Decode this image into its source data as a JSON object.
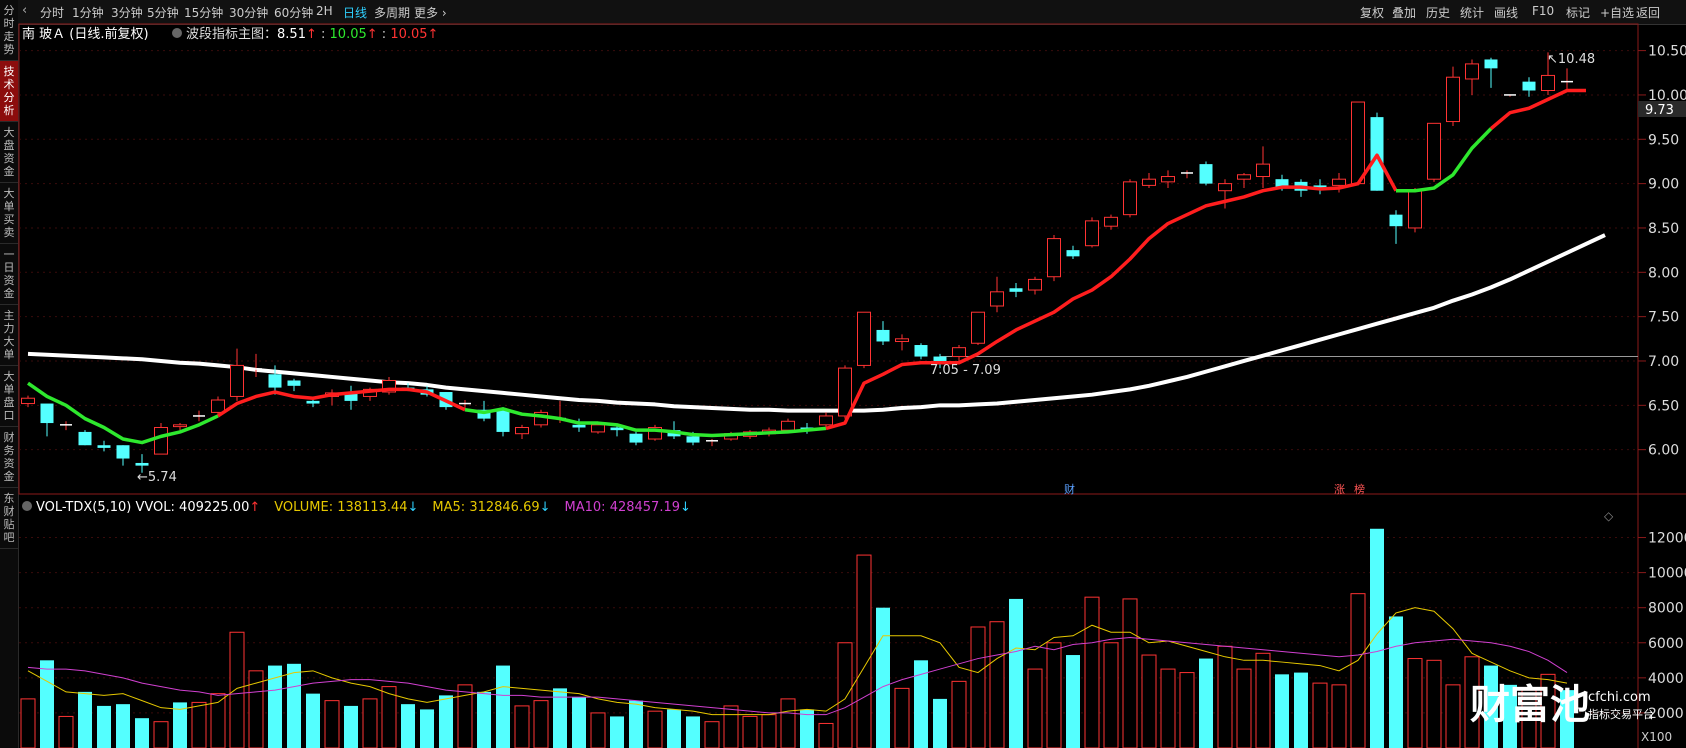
{
  "nav_left": [
    "分时走势",
    "技术分析",
    "大盘资金",
    "大单买卖",
    "一日资金",
    "主力大单",
    "大单盘口",
    "财务资金",
    "东财贴吧"
  ],
  "active_nav": 1,
  "timeframes": [
    "分时",
    "1分钟",
    "3分钟",
    "5分钟",
    "15分钟",
    "30分钟",
    "60分钟",
    "2H",
    "日线",
    "多周期",
    "更多 ›"
  ],
  "active_timeframe": 8,
  "right_toolbar": [
    "复权",
    "叠加",
    "历史",
    "统计",
    "画线",
    "F10",
    "标记",
    "+自选",
    "返回"
  ],
  "main_legend": {
    "stock": "南 玻Ａ (日线.前复权)",
    "indicator": "波段指标主图：",
    "v1": "8.51",
    "v2": "10.05",
    "v3": "10.05",
    "up_arrow": "↑",
    "color_white": "#ffffff",
    "color_green": "#2ee82e",
    "color_red": "#ff3333"
  },
  "vol_legend": {
    "name": "VOL-TDX(5,10)",
    "vvol": "VVOL: 409225.00",
    "volume": "VOLUME: 138113.44",
    "ma5": "MA5: 312846.69",
    "ma10": "MA10: 428457.19",
    "up": "↑",
    "down": "↓",
    "color_volume": "#e6c800",
    "color_ma5": "#e6c800",
    "color_ma10": "#d040d0"
  },
  "annotations": {
    "low": "5.74",
    "high": "10.48",
    "range": "7.05 - 7.09",
    "price_tag": "9.73",
    "event_cai": "财",
    "event_zhang": "涨",
    "event_bang": "榜"
  },
  "vol_unit": "X100",
  "watermark": {
    "brand": "财富池",
    "site": "cfchi.com",
    "slogan": "指标交易平台"
  },
  "chart_data": [
    {
      "type": "candlestick",
      "name": "price",
      "y_ticks": [
        "10.50",
        "10.00",
        "9.50",
        "9.00",
        "8.50",
        "8.00",
        "7.50",
        "7.00",
        "6.50",
        "6.00"
      ],
      "ylim": [
        5.5,
        10.8
      ],
      "candles": [
        [
          6.52,
          6.61,
          6.48,
          6.58
        ],
        [
          6.52,
          6.5,
          6.15,
          6.3
        ],
        [
          6.28,
          6.32,
          6.22,
          6.28
        ],
        [
          6.2,
          6.22,
          6.05,
          6.05
        ],
        [
          6.05,
          6.1,
          5.98,
          6.02
        ],
        [
          6.05,
          6.05,
          5.82,
          5.9
        ],
        [
          5.85,
          5.95,
          5.74,
          5.82
        ],
        [
          5.95,
          6.3,
          5.95,
          6.25
        ],
        [
          6.26,
          6.3,
          6.22,
          6.28
        ],
        [
          6.38,
          6.44,
          6.32,
          6.38
        ],
        [
          6.42,
          6.6,
          6.38,
          6.56
        ],
        [
          6.6,
          7.14,
          6.55,
          6.95
        ],
        [
          6.9,
          7.08,
          6.82,
          6.91
        ],
        [
          6.85,
          6.95,
          6.62,
          6.7
        ],
        [
          6.78,
          6.8,
          6.66,
          6.72
        ],
        [
          6.55,
          6.58,
          6.48,
          6.52
        ],
        [
          6.6,
          6.68,
          6.5,
          6.64
        ],
        [
          6.65,
          6.72,
          6.45,
          6.55
        ],
        [
          6.6,
          6.7,
          6.55,
          6.68
        ],
        [
          6.65,
          6.82,
          6.62,
          6.78
        ],
        [
          6.7,
          6.75,
          6.66,
          6.68
        ],
        [
          6.68,
          6.72,
          6.6,
          6.62
        ],
        [
          6.65,
          6.65,
          6.45,
          6.48
        ],
        [
          6.5,
          6.56,
          6.46,
          6.52
        ],
        [
          6.45,
          6.55,
          6.32,
          6.35
        ],
        [
          6.45,
          6.48,
          6.15,
          6.2
        ],
        [
          6.18,
          6.28,
          6.12,
          6.25
        ],
        [
          6.28,
          6.45,
          6.25,
          6.42
        ],
        [
          6.35,
          6.55,
          6.3,
          6.35
        ],
        [
          6.28,
          6.35,
          6.2,
          6.25
        ],
        [
          6.2,
          6.3,
          6.18,
          6.28
        ],
        [
          6.25,
          6.28,
          6.15,
          6.22
        ],
        [
          6.18,
          6.2,
          6.05,
          6.08
        ],
        [
          6.12,
          6.28,
          6.1,
          6.25
        ],
        [
          6.22,
          6.32,
          6.12,
          6.15
        ],
        [
          6.15,
          6.2,
          6.05,
          6.08
        ],
        [
          6.08,
          6.12,
          6.04,
          6.1
        ],
        [
          6.12,
          6.2,
          6.1,
          6.18
        ],
        [
          6.15,
          6.22,
          6.12,
          6.2
        ],
        [
          6.18,
          6.25,
          6.15,
          6.22
        ],
        [
          6.22,
          6.35,
          6.2,
          6.32
        ],
        [
          6.25,
          6.3,
          6.18,
          6.22
        ],
        [
          6.28,
          6.42,
          6.25,
          6.38
        ],
        [
          6.38,
          6.95,
          6.35,
          6.92
        ],
        [
          6.95,
          7.55,
          6.92,
          7.55
        ],
        [
          7.35,
          7.45,
          7.18,
          7.22
        ],
        [
          7.22,
          7.3,
          7.12,
          7.25
        ],
        [
          7.18,
          7.2,
          7.02,
          7.05
        ],
        [
          7.05,
          7.08,
          6.92,
          7.0
        ],
        [
          7.05,
          7.18,
          7.0,
          7.15
        ],
        [
          7.2,
          7.55,
          7.18,
          7.55
        ],
        [
          7.62,
          7.95,
          7.55,
          7.78
        ],
        [
          7.82,
          7.88,
          7.72,
          7.78
        ],
        [
          7.8,
          7.95,
          7.75,
          7.92
        ],
        [
          7.95,
          8.42,
          7.9,
          8.38
        ],
        [
          8.25,
          8.3,
          8.15,
          8.18
        ],
        [
          8.3,
          8.62,
          8.28,
          8.58
        ],
        [
          8.52,
          8.65,
          8.48,
          8.62
        ],
        [
          8.65,
          9.05,
          8.62,
          9.02
        ],
        [
          8.98,
          9.12,
          8.95,
          9.05
        ],
        [
          9.02,
          9.15,
          8.95,
          9.08
        ],
        [
          9.1,
          9.15,
          9.06,
          9.12
        ],
        [
          9.22,
          9.25,
          8.98,
          9.0
        ],
        [
          8.92,
          9.05,
          8.72,
          9.0
        ],
        [
          9.05,
          9.12,
          8.95,
          9.1
        ],
        [
          9.08,
          9.42,
          8.95,
          9.22
        ],
        [
          9.05,
          9.1,
          8.92,
          8.95
        ],
        [
          9.02,
          9.05,
          8.85,
          8.92
        ],
        [
          8.98,
          9.05,
          8.88,
          8.95
        ],
        [
          8.98,
          9.12,
          8.9,
          9.05
        ],
        [
          9.0,
          9.92,
          8.98,
          9.92
        ],
        [
          9.75,
          9.8,
          8.92,
          8.92
        ],
        [
          8.65,
          8.7,
          8.32,
          8.52
        ],
        [
          8.5,
          8.95,
          8.45,
          8.92
        ],
        [
          9.05,
          9.68,
          9.02,
          9.68
        ],
        [
          9.7,
          10.32,
          9.65,
          10.2
        ],
        [
          10.18,
          10.4,
          10.0,
          10.35
        ],
        [
          10.4,
          10.42,
          10.08,
          10.3
        ],
        [
          10.0,
          10.0,
          9.98,
          10.0
        ],
        [
          10.15,
          10.2,
          9.98,
          10.05
        ],
        [
          10.05,
          10.48,
          10.0,
          10.22
        ],
        [
          10.15,
          10.3,
          10.05,
          10.15
        ]
      ],
      "bottom_line": [
        6.75,
        6.6,
        6.5,
        6.35,
        6.25,
        6.12,
        6.08,
        6.15,
        6.2,
        6.28,
        6.38,
        6.52,
        6.6,
        6.65,
        6.6,
        6.58,
        6.62,
        6.64,
        6.66,
        6.68,
        6.68,
        6.65,
        6.55,
        6.45,
        6.42,
        6.46,
        6.4,
        6.38,
        6.35,
        6.3,
        6.3,
        6.28,
        6.22,
        6.22,
        6.2,
        6.17,
        6.16,
        6.17,
        6.18,
        6.19,
        6.2,
        6.22,
        6.24,
        6.3,
        6.75,
        6.85,
        6.96,
        6.98,
        6.98,
        6.98,
        7.08,
        7.22,
        7.35,
        7.45,
        7.55,
        7.7,
        7.8,
        7.95,
        8.15,
        8.38,
        8.55,
        8.65,
        8.75,
        8.8,
        8.85,
        8.92,
        8.96,
        8.96,
        8.94,
        8.95,
        9.0,
        9.32,
        8.92,
        8.92,
        8.95,
        9.1,
        9.4,
        9.62,
        9.8,
        9.85,
        9.95,
        10.05,
        10.05
      ],
      "bottom_segments": [
        {
          "from": 0,
          "to": 10,
          "color": "green"
        },
        {
          "from": 10,
          "to": 23,
          "color": "red"
        },
        {
          "from": 23,
          "to": 42,
          "color": "green"
        },
        {
          "from": 42,
          "to": 72,
          "color": "red"
        },
        {
          "from": 72,
          "to": 77,
          "color": "green"
        },
        {
          "from": 77,
          "to": 82,
          "color": "red"
        }
      ],
      "ma_line": [
        7.08,
        7.07,
        7.06,
        7.05,
        7.04,
        7.03,
        7.02,
        7.0,
        6.98,
        6.97,
        6.95,
        6.93,
        6.9,
        6.88,
        6.86,
        6.84,
        6.82,
        6.8,
        6.78,
        6.76,
        6.75,
        6.73,
        6.7,
        6.68,
        6.66,
        6.64,
        6.62,
        6.6,
        6.58,
        6.56,
        6.55,
        6.53,
        6.52,
        6.51,
        6.49,
        6.48,
        6.47,
        6.46,
        6.45,
        6.45,
        6.44,
        6.44,
        6.44,
        6.44,
        6.44,
        6.45,
        6.47,
        6.48,
        6.5,
        6.5,
        6.51,
        6.52,
        6.54,
        6.56,
        6.58,
        6.6,
        6.62,
        6.65,
        6.68,
        6.72,
        6.77,
        6.82,
        6.88,
        6.94,
        7.0,
        7.06,
        7.12,
        7.18,
        7.24,
        7.3,
        7.36,
        7.42,
        7.48,
        7.54,
        7.6,
        7.68,
        7.75,
        7.83,
        7.92,
        8.02,
        8.12,
        8.22,
        8.32,
        8.42
      ],
      "ref_line": 7.05
    },
    {
      "type": "bar",
      "name": "volume",
      "y_ticks": [
        "12000",
        "10000",
        "8000",
        "6000",
        "4000",
        "2000"
      ],
      "ylim": [
        0,
        13000
      ],
      "values": [
        2800,
        5000,
        1800,
        3200,
        2400,
        2500,
        1700,
        1500,
        2600,
        2600,
        3100,
        6600,
        4400,
        4700,
        4800,
        3100,
        2700,
        2400,
        2800,
        3500,
        2500,
        2200,
        3000,
        3600,
        3200,
        4700,
        2400,
        2700,
        3400,
        2900,
        2000,
        1800,
        2700,
        2100,
        2200,
        1800,
        1500,
        2400,
        1800,
        1900,
        2800,
        2200,
        1400,
        6000,
        11000,
        8000,
        3400,
        5000,
        2800,
        3800,
        6900,
        7200,
        8500,
        4500,
        6000,
        5300,
        8600,
        6000,
        8500,
        5300,
        4500,
        4300,
        5100,
        5800,
        4500,
        5400,
        4200,
        4300,
        3700,
        3600,
        8800,
        12500,
        7500,
        5100,
        5000,
        3600,
        5200,
        4700,
        3600,
        3300,
        4200,
        3300
      ],
      "up": [
        1,
        0,
        1,
        0,
        0,
        0,
        0,
        1,
        0,
        1,
        1,
        1,
        1,
        0,
        0,
        0,
        1,
        0,
        1,
        1,
        0,
        0,
        0,
        1,
        0,
        0,
        1,
        1,
        0,
        0,
        1,
        0,
        0,
        1,
        0,
        0,
        1,
        1,
        1,
        1,
        1,
        0,
        1,
        1,
        1,
        0,
        1,
        0,
        0,
        1,
        1,
        1,
        0,
        1,
        1,
        0,
        1,
        1,
        1,
        1,
        1,
        1,
        0,
        1,
        1,
        1,
        0,
        0,
        1,
        1,
        1,
        0,
        0,
        1,
        1,
        1,
        1,
        0,
        0,
        1,
        1,
        0
      ],
      "ma5": [
        4400,
        3800,
        3200,
        3100,
        3000,
        3100,
        2700,
        2300,
        2200,
        2400,
        2600,
        3400,
        3700,
        4000,
        4300,
        4400,
        4000,
        3700,
        3500,
        3100,
        2800,
        2600,
        2800,
        3000,
        3200,
        3500,
        3400,
        3300,
        3200,
        3100,
        2800,
        2600,
        2500,
        2300,
        2200,
        2100,
        1900,
        1900,
        1900,
        1900,
        2100,
        2200,
        2100,
        2800,
        4600,
        6400,
        6400,
        6400,
        6000,
        4600,
        4300,
        5100,
        5700,
        5600,
        6300,
        6400,
        7000,
        6600,
        6600,
        6000,
        6100,
        5800,
        5500,
        5200,
        5000,
        5000,
        4900,
        4800,
        4700,
        4400,
        5000,
        6500,
        7700,
        8000,
        7800,
        6800,
        5400,
        4900,
        4400,
        4000,
        3900,
        3700
      ],
      "ma10": [
        4600,
        4500,
        4500,
        4400,
        4200,
        4000,
        3700,
        3500,
        3300,
        3200,
        3000,
        3100,
        3200,
        3300,
        3500,
        3700,
        3800,
        3900,
        3900,
        3800,
        3700,
        3500,
        3300,
        3200,
        3100,
        3000,
        3000,
        2900,
        2900,
        2900,
        2900,
        2800,
        2700,
        2600,
        2500,
        2400,
        2300,
        2200,
        2100,
        2000,
        2000,
        1900,
        1900,
        2300,
        2900,
        3500,
        3900,
        4200,
        4500,
        4800,
        5100,
        5300,
        5500,
        5800,
        5600,
        5900,
        6000,
        6200,
        6300,
        6200,
        6100,
        6000,
        5900,
        5800,
        5700,
        5600,
        5500,
        5400,
        5300,
        5200,
        5300,
        5500,
        5800,
        6000,
        6100,
        6200,
        6100,
        6000,
        5800,
        5500,
        5000,
        4300
      ]
    }
  ]
}
